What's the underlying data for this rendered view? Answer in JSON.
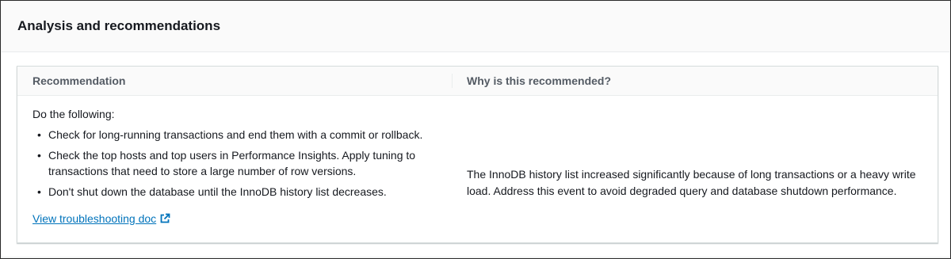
{
  "panel": {
    "title": "Analysis and recommendations"
  },
  "table": {
    "columns": [
      "Recommendation",
      "Why is this recommended?"
    ],
    "recommendation": {
      "intro": "Do the following:",
      "steps": [
        "Check for long-running transactions and end them with a commit or rollback.",
        "Check the top hosts and top users in Performance Insights. Apply tuning to transactions that need to store a large number of row versions.",
        "Don't shut down the database until the InnoDB history list decreases."
      ],
      "link_label": "View troubleshooting doc",
      "link_icon": "external-link-icon"
    },
    "reason": "The InnoDB history list increased significantly because of long transactions or a heavy write load. Address this event to avoid degraded query and database shutdown performance."
  },
  "colors": {
    "link": "#0073bb",
    "header_bg": "#fafafa",
    "text": "#16191f",
    "column_header_text": "#545b64"
  }
}
